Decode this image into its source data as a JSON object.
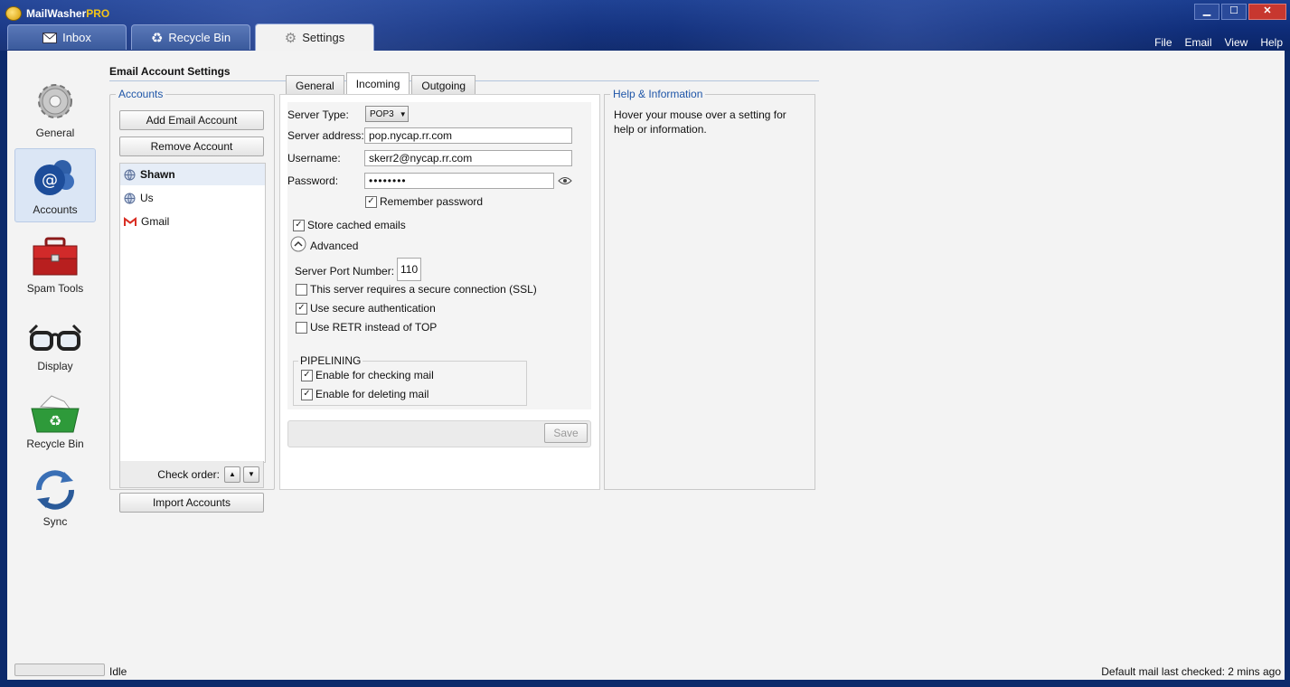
{
  "app": {
    "name": "MailWasher",
    "name_suffix": "PRO"
  },
  "window_controls": {
    "minimize": "▁",
    "maximize": "☐",
    "close": "✕"
  },
  "main_tabs": [
    {
      "label": "Inbox",
      "icon": "envelope-icon"
    },
    {
      "label": "Recycle Bin",
      "icon": "recycle-icon"
    },
    {
      "label": "Settings",
      "icon": "gear-icon",
      "active": true
    }
  ],
  "menu": [
    "File",
    "Email",
    "View",
    "Help"
  ],
  "sidenav": [
    {
      "label": "General",
      "icon": "gear-icon"
    },
    {
      "label": "Accounts",
      "icon": "at-sign-icon",
      "active": true
    },
    {
      "label": "Spam Tools",
      "icon": "toolbox-icon"
    },
    {
      "label": "Display",
      "icon": "glasses-icon"
    },
    {
      "label": "Recycle Bin",
      "icon": "recycle-bin-icon"
    },
    {
      "label": "Sync",
      "icon": "sync-icon"
    }
  ],
  "page_heading": "Email Account Settings",
  "accounts": {
    "label": "Accounts",
    "add_button": "Add Email Account",
    "remove_button": "Remove Account",
    "items": [
      {
        "name": "Shawn",
        "icon": "globe-icon",
        "selected": true
      },
      {
        "name": "Us",
        "icon": "globe-icon"
      },
      {
        "name": "Gmail",
        "icon": "gmail-icon"
      }
    ],
    "check_order_label": "Check order:",
    "up_arrow": "▲",
    "down_arrow": "▼",
    "import_button": "Import Accounts"
  },
  "settings_tabs": [
    {
      "label": "General"
    },
    {
      "label": "Incoming",
      "active": true
    },
    {
      "label": "Outgoing"
    }
  ],
  "incoming": {
    "server_type_label": "Server Type:",
    "server_type_value": "POP3",
    "server_address_label": "Server address:",
    "server_address_value": "pop.nycap.rr.com",
    "username_label": "Username:",
    "username_value": "skerr2@nycap.rr.com",
    "password_label": "Password:",
    "password_value": "••••••••",
    "remember_password": {
      "label": "Remember password",
      "checked": true
    },
    "store_cached": {
      "label": "Store cached emails",
      "checked": true
    },
    "advanced_label": "Advanced",
    "port_label": "Server Port Number:",
    "port_value": "110",
    "ssl": {
      "label": "This server requires a secure connection (SSL)",
      "checked": false
    },
    "secure_auth": {
      "label": "Use secure authentication",
      "checked": true
    },
    "use_retr": {
      "label": "Use RETR instead of TOP",
      "checked": false
    },
    "pipelining_label": "PIPELINING",
    "pipelining_checking": {
      "label": "Enable for checking mail",
      "checked": true
    },
    "pipelining_deleting": {
      "label": "Enable for deleting mail",
      "checked": true
    },
    "save_button": "Save"
  },
  "help": {
    "label": "Help & Information",
    "text": "Hover your mouse over a setting for help or information."
  },
  "status": {
    "state": "Idle",
    "last_checked": "Default mail last checked: 2 mins ago"
  },
  "colors": {
    "accent": "#1f56a8",
    "titlebar": "#0e2c78"
  }
}
